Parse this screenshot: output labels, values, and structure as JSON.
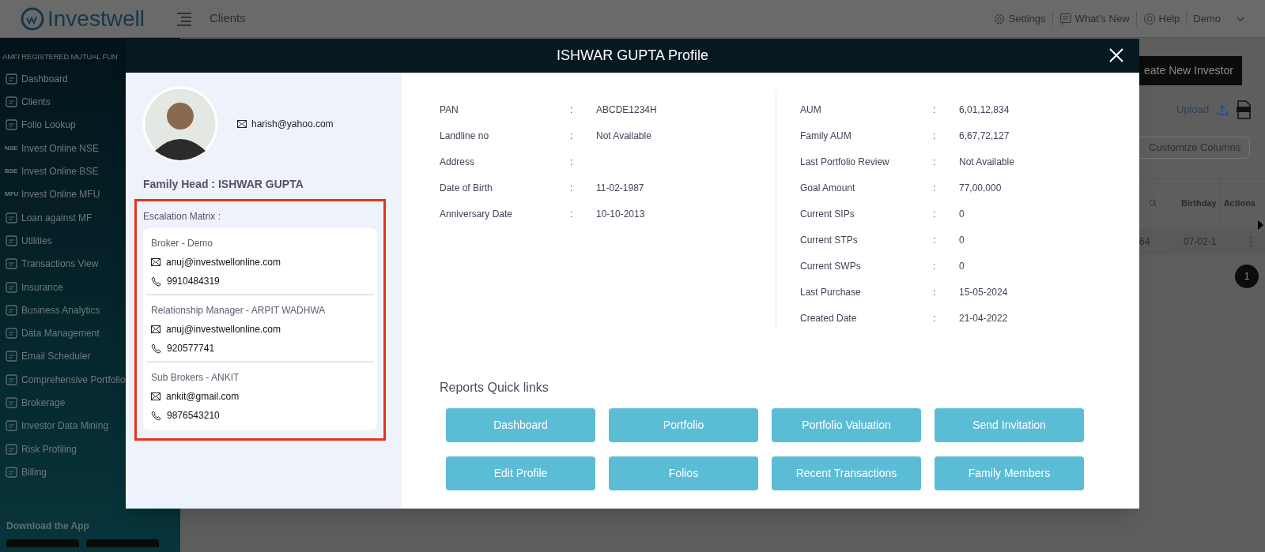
{
  "header": {
    "logo": "Investwell",
    "page_title": "Clients",
    "actions": [
      {
        "label": "Settings"
      },
      {
        "label": "What's New"
      },
      {
        "label": "Help"
      }
    ],
    "user": "Demo"
  },
  "sidebar": {
    "section_label": "AMFI REGISTERED MUTUAL FUN",
    "items": [
      {
        "label": "Dashboard"
      },
      {
        "label": "Clients"
      },
      {
        "label": "Folio Lookup"
      },
      {
        "label": "Invest Online NSE",
        "badge": "NSE"
      },
      {
        "label": "Invest Online BSE",
        "badge": "BSE"
      },
      {
        "label": "Invest Online MFU",
        "badge": "MFU"
      },
      {
        "label": "Loan against MF"
      },
      {
        "label": "Utilities"
      },
      {
        "label": "Transactions View"
      },
      {
        "label": "Insurance"
      },
      {
        "label": "Business Analytics"
      },
      {
        "label": "Data Management"
      },
      {
        "label": "Email Scheduler"
      },
      {
        "label": "Comprehensive Portfolio"
      },
      {
        "label": "Brokerage"
      },
      {
        "label": "Investor Data Mining"
      },
      {
        "label": "Risk Profiling"
      },
      {
        "label": "Billing"
      }
    ],
    "download_label": "Download the App"
  },
  "background": {
    "create_button": "eate New Investor",
    "upload_label": "Upload",
    "customize_button": "Customize Columns",
    "columns": [
      "Birthday",
      "Actions"
    ],
    "row": [
      "64",
      "07-02-1"
    ],
    "page": "1"
  },
  "modal": {
    "title": "ISHWAR GUPTA Profile",
    "email": "harish@yahoo.com",
    "family_head": "Family Head : ISHWAR GUPTA",
    "escalation": {
      "title": "Escalation Matrix :",
      "contacts": [
        {
          "role": "Broker - Demo",
          "email": "anuj@investwellonline.com",
          "phone": "9910484319"
        },
        {
          "role": "Relationship Manager - ARPIT WADHWA",
          "email": "anuj@investwellonline.com",
          "phone": "920577741"
        },
        {
          "role": "Sub Brokers - ANKIT",
          "email": "ankit@gmail.com",
          "phone": "9876543210"
        }
      ]
    },
    "details_left": [
      {
        "label": "PAN",
        "sep": ":",
        "value": "ABCDE1234H"
      },
      {
        "label": "Landline no",
        "sep": ":",
        "value": "Not Available"
      },
      {
        "label": "Address",
        "sep": ":"
      },
      {
        "label": "Date of Birth",
        "sep": ":",
        "value": "11-02-1987"
      },
      {
        "label": "Anniversary Date",
        "sep": ":",
        "value": "10-10-2013"
      }
    ],
    "details_right": [
      {
        "label": "AUM",
        "sep": ":",
        "value": "6,01,12,834"
      },
      {
        "label": "Family AUM",
        "sep": ":",
        "value": "6,67,72,127"
      },
      {
        "label": "Last Portfolio Review",
        "sep": ":",
        "value": "Not Available"
      },
      {
        "label": "Goal Amount",
        "sep": ":",
        "value": "77,00,000"
      },
      {
        "label": "Current SIPs",
        "sep": ":",
        "value": "0"
      },
      {
        "label": "Current STPs",
        "sep": ":",
        "value": "0"
      },
      {
        "label": "Current SWPs",
        "sep": ":",
        "value": "0"
      },
      {
        "label": "Last Purchase",
        "sep": ":",
        "value": "15-05-2024"
      },
      {
        "label": "Created Date",
        "sep": ":",
        "value": "21-04-2022"
      }
    ],
    "reports_title": "Reports Quick links",
    "quick_links": [
      "Dashboard",
      "Portfolio",
      "Portfolio Valuation",
      "Send Invitation",
      "Edit Profile",
      "Folios",
      "Recent Transactions",
      "Family Members"
    ]
  }
}
